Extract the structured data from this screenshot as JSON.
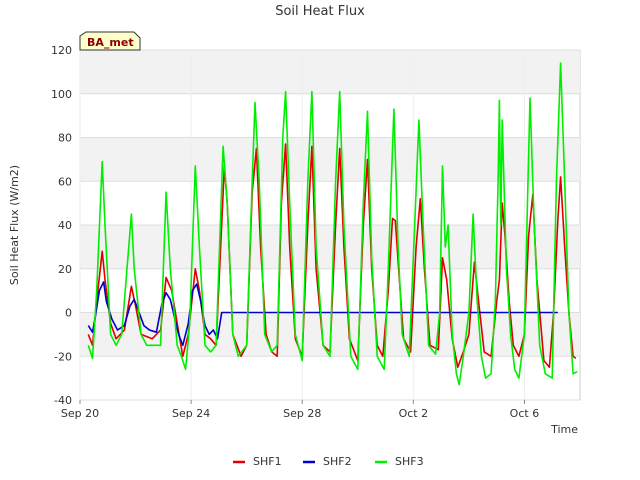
{
  "chart_data": {
    "type": "line",
    "title": "Soil Heat Flux",
    "xlabel": "Time",
    "ylabel": "Soil Heat Flux (W/m2)",
    "badge": "BA_met",
    "ylim": [
      -40,
      120
    ],
    "xlim": [
      0,
      18
    ],
    "x_ticks": [
      {
        "day": 0,
        "label": "Sep 20"
      },
      {
        "day": 4,
        "label": "Sep 24"
      },
      {
        "day": 8,
        "label": "Sep 28"
      },
      {
        "day": 12,
        "label": "Oct 2"
      },
      {
        "day": 16,
        "label": "Oct 6"
      }
    ],
    "y_ticks": [
      -40,
      -20,
      0,
      20,
      40,
      60,
      80,
      100,
      120
    ],
    "grid": true,
    "legend_position": "bottom",
    "x_units": "days since Sep 20",
    "series": [
      {
        "name": "SHF1",
        "color": "#e00000",
        "points": [
          [
            0.3,
            -10
          ],
          [
            0.45,
            -15
          ],
          [
            0.6,
            5
          ],
          [
            0.8,
            28
          ],
          [
            0.9,
            15
          ],
          [
            1.1,
            -5
          ],
          [
            1.3,
            -12
          ],
          [
            1.6,
            -8
          ],
          [
            1.85,
            12
          ],
          [
            2.0,
            3
          ],
          [
            2.2,
            -10
          ],
          [
            2.6,
            -12
          ],
          [
            2.9,
            -8
          ],
          [
            3.1,
            16
          ],
          [
            3.3,
            10
          ],
          [
            3.5,
            -5
          ],
          [
            3.7,
            -20
          ],
          [
            3.9,
            -10
          ],
          [
            4.15,
            20
          ],
          [
            4.3,
            10
          ],
          [
            4.5,
            -10
          ],
          [
            4.7,
            -12
          ],
          [
            4.9,
            -15
          ],
          [
            5.2,
            67
          ],
          [
            5.3,
            50
          ],
          [
            5.5,
            -10
          ],
          [
            5.8,
            -20
          ],
          [
            6.0,
            -15
          ],
          [
            6.2,
            55
          ],
          [
            6.35,
            75
          ],
          [
            6.5,
            30
          ],
          [
            6.7,
            -10
          ],
          [
            6.9,
            -18
          ],
          [
            7.1,
            -20
          ],
          [
            7.25,
            50
          ],
          [
            7.4,
            77
          ],
          [
            7.55,
            30
          ],
          [
            7.75,
            -12
          ],
          [
            8.0,
            -20
          ],
          [
            8.2,
            40
          ],
          [
            8.35,
            76
          ],
          [
            8.5,
            20
          ],
          [
            8.75,
            -15
          ],
          [
            9.0,
            -18
          ],
          [
            9.2,
            40
          ],
          [
            9.35,
            75
          ],
          [
            9.5,
            30
          ],
          [
            9.7,
            -12
          ],
          [
            10.0,
            -22
          ],
          [
            10.2,
            40
          ],
          [
            10.35,
            70
          ],
          [
            10.5,
            20
          ],
          [
            10.7,
            -15
          ],
          [
            10.9,
            -20
          ],
          [
            11.1,
            10
          ],
          [
            11.25,
            43
          ],
          [
            11.35,
            42
          ],
          [
            11.5,
            15
          ],
          [
            11.65,
            -12
          ],
          [
            11.9,
            -18
          ],
          [
            12.1,
            30
          ],
          [
            12.25,
            52
          ],
          [
            12.4,
            20
          ],
          [
            12.6,
            -15
          ],
          [
            12.9,
            -17
          ],
          [
            13.05,
            25
          ],
          [
            13.2,
            15
          ],
          [
            13.4,
            -12
          ],
          [
            13.6,
            -25
          ],
          [
            13.8,
            -18
          ],
          [
            14.0,
            -10
          ],
          [
            14.2,
            23
          ],
          [
            14.35,
            5
          ],
          [
            14.55,
            -18
          ],
          [
            14.8,
            -20
          ],
          [
            15.0,
            5
          ],
          [
            15.1,
            15
          ],
          [
            15.2,
            50
          ],
          [
            15.3,
            35
          ],
          [
            15.45,
            5
          ],
          [
            15.6,
            -15
          ],
          [
            15.8,
            -20
          ],
          [
            16.0,
            -10
          ],
          [
            16.15,
            35
          ],
          [
            16.3,
            54
          ],
          [
            16.45,
            15
          ],
          [
            16.7,
            -22
          ],
          [
            16.9,
            -25
          ],
          [
            17.05,
            0
          ],
          [
            17.2,
            42
          ],
          [
            17.3,
            62
          ],
          [
            17.45,
            30
          ],
          [
            17.6,
            0
          ],
          [
            17.75,
            -20
          ],
          [
            17.85,
            -21
          ]
        ]
      },
      {
        "name": "SHF2",
        "color": "#0000cc",
        "points": [
          [
            0.3,
            -6
          ],
          [
            0.45,
            -9
          ],
          [
            0.55,
            -2
          ],
          [
            0.7,
            10
          ],
          [
            0.85,
            14
          ],
          [
            0.95,
            5
          ],
          [
            1.15,
            -3
          ],
          [
            1.35,
            -8
          ],
          [
            1.6,
            -6
          ],
          [
            1.8,
            3
          ],
          [
            1.95,
            6
          ],
          [
            2.1,
            1
          ],
          [
            2.3,
            -6
          ],
          [
            2.5,
            -8
          ],
          [
            2.75,
            -9
          ],
          [
            2.95,
            4
          ],
          [
            3.1,
            9
          ],
          [
            3.25,
            6
          ],
          [
            3.4,
            -2
          ],
          [
            3.55,
            -10
          ],
          [
            3.7,
            -15
          ],
          [
            3.9,
            -5
          ],
          [
            4.05,
            10
          ],
          [
            4.2,
            13
          ],
          [
            4.35,
            5
          ],
          [
            4.5,
            -6
          ],
          [
            4.65,
            -10
          ],
          [
            4.8,
            -8
          ],
          [
            4.95,
            -12
          ],
          [
            5.1,
            0
          ],
          [
            10.0,
            0
          ],
          [
            14.0,
            0
          ],
          [
            17.2,
            0
          ]
        ]
      },
      {
        "name": "SHF3",
        "color": "#00ee00",
        "points": [
          [
            0.3,
            -15
          ],
          [
            0.45,
            -21
          ],
          [
            0.6,
            10
          ],
          [
            0.8,
            69
          ],
          [
            0.9,
            40
          ],
          [
            1.1,
            -10
          ],
          [
            1.3,
            -15
          ],
          [
            1.5,
            -10
          ],
          [
            1.85,
            45
          ],
          [
            1.95,
            20
          ],
          [
            2.2,
            -10
          ],
          [
            2.4,
            -15
          ],
          [
            2.9,
            -15
          ],
          [
            3.1,
            55
          ],
          [
            3.25,
            20
          ],
          [
            3.5,
            -15
          ],
          [
            3.65,
            -20
          ],
          [
            3.8,
            -26
          ],
          [
            3.95,
            -5
          ],
          [
            4.15,
            67
          ],
          [
            4.3,
            30
          ],
          [
            4.5,
            -15
          ],
          [
            4.7,
            -18
          ],
          [
            4.9,
            -15
          ],
          [
            5.15,
            76
          ],
          [
            5.3,
            50
          ],
          [
            5.5,
            -10
          ],
          [
            5.7,
            -20
          ],
          [
            6.0,
            -15
          ],
          [
            6.2,
            60
          ],
          [
            6.3,
            96
          ],
          [
            6.45,
            60
          ],
          [
            6.65,
            -10
          ],
          [
            6.9,
            -18
          ],
          [
            7.1,
            -15
          ],
          [
            7.3,
            80
          ],
          [
            7.4,
            101
          ],
          [
            7.55,
            50
          ],
          [
            7.75,
            -10
          ],
          [
            8.0,
            -22
          ],
          [
            8.2,
            60
          ],
          [
            8.35,
            101
          ],
          [
            8.5,
            30
          ],
          [
            8.75,
            -15
          ],
          [
            9.0,
            -20
          ],
          [
            9.2,
            60
          ],
          [
            9.35,
            101
          ],
          [
            9.5,
            40
          ],
          [
            9.75,
            -20
          ],
          [
            10.0,
            -26
          ],
          [
            10.2,
            50
          ],
          [
            10.35,
            92
          ],
          [
            10.5,
            25
          ],
          [
            10.7,
            -20
          ],
          [
            10.95,
            -26
          ],
          [
            11.1,
            20
          ],
          [
            11.3,
            93
          ],
          [
            11.45,
            30
          ],
          [
            11.6,
            -10
          ],
          [
            11.85,
            -20
          ],
          [
            12.05,
            40
          ],
          [
            12.2,
            88
          ],
          [
            12.35,
            40
          ],
          [
            12.55,
            -15
          ],
          [
            12.8,
            -19
          ],
          [
            12.95,
            0
          ],
          [
            13.05,
            67
          ],
          [
            13.15,
            30
          ],
          [
            13.25,
            40
          ],
          [
            13.4,
            -10
          ],
          [
            13.55,
            -28
          ],
          [
            13.65,
            -33
          ],
          [
            13.8,
            -20
          ],
          [
            14.0,
            0
          ],
          [
            14.15,
            45
          ],
          [
            14.3,
            5
          ],
          [
            14.45,
            -20
          ],
          [
            14.6,
            -30
          ],
          [
            14.8,
            -28
          ],
          [
            14.95,
            5
          ],
          [
            15.05,
            60
          ],
          [
            15.1,
            97
          ],
          [
            15.15,
            40
          ],
          [
            15.2,
            88
          ],
          [
            15.35,
            20
          ],
          [
            15.5,
            -10
          ],
          [
            15.65,
            -26
          ],
          [
            15.8,
            -30
          ],
          [
            16.0,
            -10
          ],
          [
            16.1,
            45
          ],
          [
            16.2,
            98
          ],
          [
            16.35,
            40
          ],
          [
            16.55,
            -15
          ],
          [
            16.75,
            -28
          ],
          [
            17.0,
            -30
          ],
          [
            17.15,
            60
          ],
          [
            17.3,
            114
          ],
          [
            17.45,
            60
          ],
          [
            17.6,
            0
          ],
          [
            17.75,
            -28
          ],
          [
            17.9,
            -27
          ]
        ]
      }
    ]
  }
}
